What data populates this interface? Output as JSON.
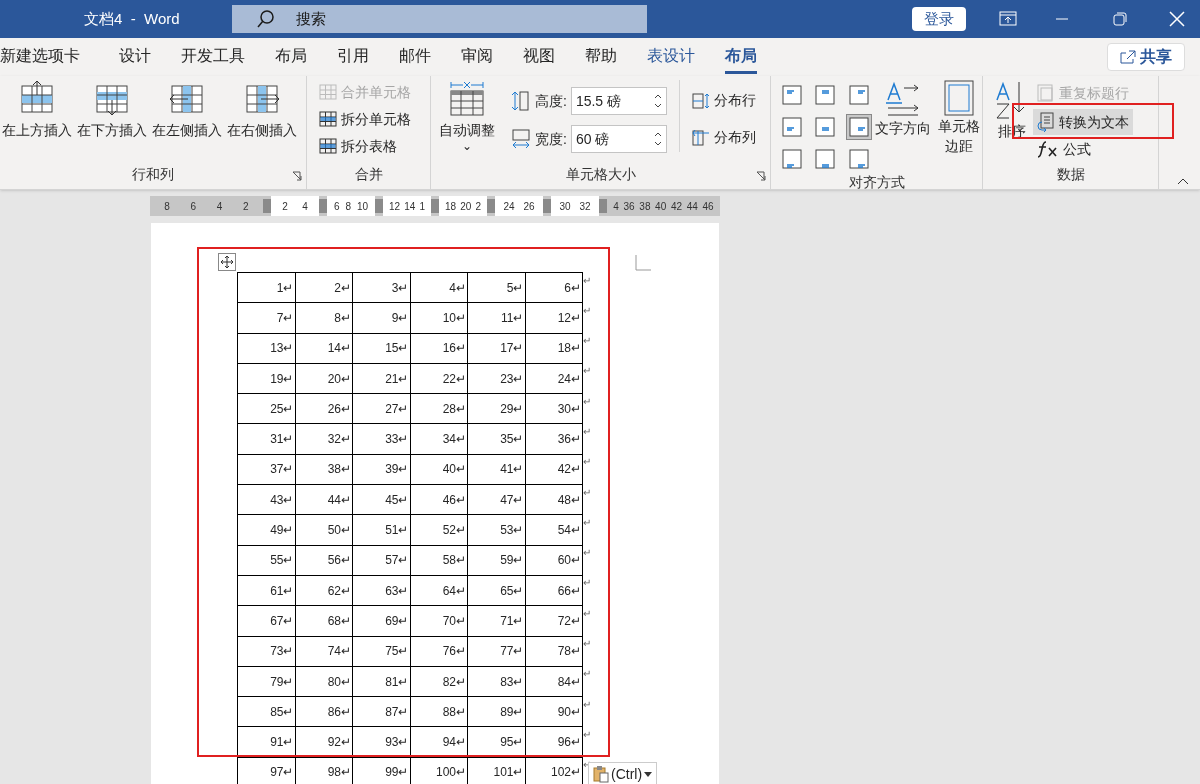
{
  "window": {
    "title": "文档4  -  Word",
    "search_placeholder": "搜索",
    "signin": "登录"
  },
  "tabs": [
    {
      "label": "新建选项卡",
      "selected": false,
      "contextual": false
    },
    {
      "label": "设计",
      "selected": false,
      "contextual": false
    },
    {
      "label": "开发工具",
      "selected": false,
      "contextual": false
    },
    {
      "label": "布局",
      "selected": false,
      "contextual": false
    },
    {
      "label": "引用",
      "selected": false,
      "contextual": false
    },
    {
      "label": "邮件",
      "selected": false,
      "contextual": false
    },
    {
      "label": "审阅",
      "selected": false,
      "contextual": false
    },
    {
      "label": "视图",
      "selected": false,
      "contextual": false
    },
    {
      "label": "帮助",
      "selected": false,
      "contextual": false
    },
    {
      "label": "表设计",
      "selected": false,
      "contextual": true
    },
    {
      "label": "布局",
      "selected": true,
      "contextual": true
    }
  ],
  "share": "共享",
  "ribbon": {
    "rows_columns": {
      "title": "行和列",
      "launcher": true,
      "buttons": [
        "在上方插入",
        "在下方插入",
        "在左侧插入",
        "在右侧插入"
      ]
    },
    "merge": {
      "title": "合并",
      "buttons": [
        {
          "label": "合并单元格",
          "disabled": true
        },
        {
          "label": "拆分单元格",
          "disabled": false
        },
        {
          "label": "拆分表格",
          "disabled": false
        }
      ]
    },
    "cell_size": {
      "title": "单元格大小",
      "launcher": true,
      "autofit": "自动调整",
      "autofit_caret": "⌄",
      "height": {
        "label": "高度:",
        "value": "15.5 磅"
      },
      "width": {
        "label": "宽度:",
        "value": "60 磅"
      },
      "distribute": [
        "分布行",
        "分布列"
      ]
    },
    "alignment": {
      "title": "对齐方式",
      "cells": [
        {
          "selected": false
        },
        {
          "selected": false
        },
        {
          "selected": false
        },
        {
          "selected": false
        },
        {
          "selected": false
        },
        {
          "selected": true
        },
        {
          "selected": false
        },
        {
          "selected": false
        },
        {
          "selected": false
        }
      ],
      "direction": "文字方向",
      "margins": "单元格边距"
    },
    "data": {
      "title": "数据",
      "sort": "排序",
      "repeat_header": {
        "label": "重复标题行",
        "disabled": true
      },
      "convert": {
        "label": "转换为文本",
        "highlighted": true
      },
      "formula": "公式"
    }
  },
  "ruler": [
    {
      "white": false,
      "labels": [
        "8",
        "6",
        "4",
        "2"
      ]
    },
    {
      "white": true,
      "labels": [
        "2",
        "4"
      ]
    },
    {
      "white": true,
      "labels": [
        "6",
        "8",
        "10"
      ]
    },
    {
      "white": true,
      "labels": [
        "12",
        "14",
        "1"
      ]
    },
    {
      "white": true,
      "labels": [
        "18",
        "20",
        "2"
      ]
    },
    {
      "white": true,
      "labels": [
        "24",
        "26"
      ]
    },
    {
      "white": true,
      "labels": [
        "30",
        "32"
      ]
    },
    {
      "white": false,
      "labels": [
        "4",
        "36",
        "38",
        "40",
        "42",
        "44",
        "46"
      ]
    }
  ],
  "table": {
    "rows": [
      {
        "cells": [
          "1↵",
          "2↵",
          "3↵",
          "4↵",
          "5↵",
          "6↵"
        ],
        "end_mark": "↵"
      },
      {
        "cells": [
          "7↵",
          "8↵",
          "9↵",
          "10↵",
          "11↵",
          "12↵"
        ],
        "end_mark": "↵"
      },
      {
        "cells": [
          "13↵",
          "14↵",
          "15↵",
          "16↵",
          "17↵",
          "18↵"
        ],
        "end_mark": "↵"
      },
      {
        "cells": [
          "19↵",
          "20↵",
          "21↵",
          "22↵",
          "23↵",
          "24↵"
        ],
        "end_mark": "↵"
      },
      {
        "cells": [
          "25↵",
          "26↵",
          "27↵",
          "28↵",
          "29↵",
          "30↵"
        ],
        "end_mark": "↵"
      },
      {
        "cells": [
          "31↵",
          "32↵",
          "33↵",
          "34↵",
          "35↵",
          "36↵"
        ],
        "end_mark": "↵"
      },
      {
        "cells": [
          "37↵",
          "38↵",
          "39↵",
          "40↵",
          "41↵",
          "42↵"
        ],
        "end_mark": "↵"
      },
      {
        "cells": [
          "43↵",
          "44↵",
          "45↵",
          "46↵",
          "47↵",
          "48↵"
        ],
        "end_mark": "↵"
      },
      {
        "cells": [
          "49↵",
          "50↵",
          "51↵",
          "52↵",
          "53↵",
          "54↵"
        ],
        "end_mark": "↵"
      },
      {
        "cells": [
          "55↵",
          "56↵",
          "57↵",
          "58↵",
          "59↵",
          "60↵"
        ],
        "end_mark": "↵"
      },
      {
        "cells": [
          "61↵",
          "62↵",
          "63↵",
          "64↵",
          "65↵",
          "66↵"
        ],
        "end_mark": "↵"
      },
      {
        "cells": [
          "67↵",
          "68↵",
          "69↵",
          "70↵",
          "71↵",
          "72↵"
        ],
        "end_mark": "↵"
      },
      {
        "cells": [
          "73↵",
          "74↵",
          "75↵",
          "76↵",
          "77↵",
          "78↵"
        ],
        "end_mark": "↵"
      },
      {
        "cells": [
          "79↵",
          "80↵",
          "81↵",
          "82↵",
          "83↵",
          "84↵"
        ],
        "end_mark": "↵"
      },
      {
        "cells": [
          "85↵",
          "86↵",
          "87↵",
          "88↵",
          "89↵",
          "90↵"
        ],
        "end_mark": "↵"
      },
      {
        "cells": [
          "91↵",
          "92↵",
          "93↵",
          "94↵",
          "95↵",
          "96↵"
        ],
        "end_mark": "↵"
      },
      {
        "cells": [
          "97↵",
          "98↵",
          "99↵",
          "100↵",
          "101↵",
          "102↵"
        ],
        "end_mark": "↵"
      }
    ]
  },
  "paste_options": {
    "label": "(Ctrl)"
  }
}
